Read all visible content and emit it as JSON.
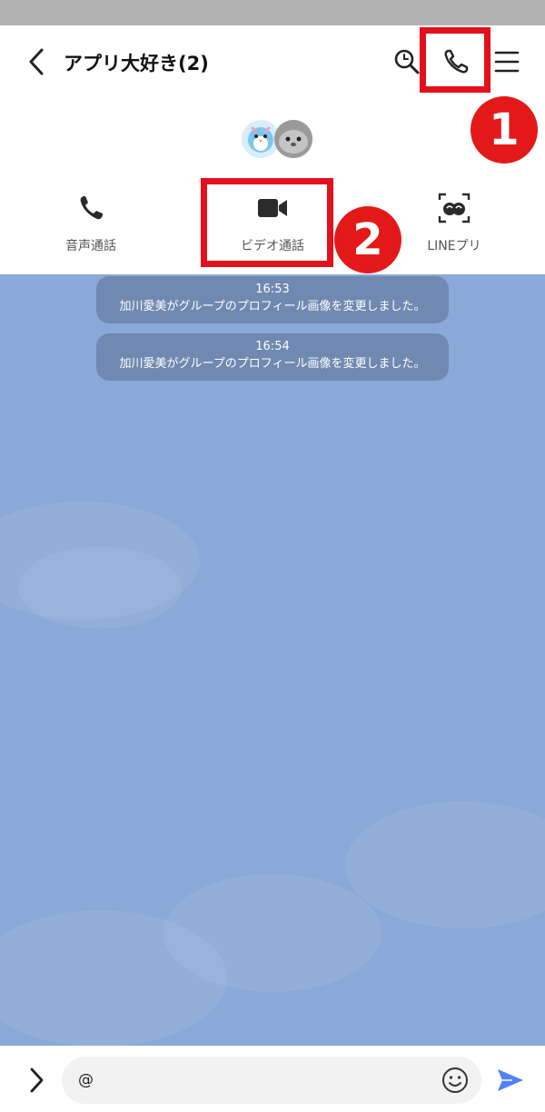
{
  "header": {
    "title": "アプリ大好き(2)",
    "back_icon": "back-arrow-icon",
    "search_icon": "search-icon",
    "call_icon": "phone-icon",
    "menu_icon": "hamburger-menu-icon"
  },
  "call_options": [
    {
      "label": "音声通話",
      "icon": "phone-icon"
    },
    {
      "label": "ビデオ通話",
      "icon": "video-camera-icon"
    },
    {
      "label": "LINEプリ",
      "icon": "line-puri-icon"
    }
  ],
  "annotations": {
    "badge_1": "1",
    "badge_2": "2",
    "color": "#e3101e"
  },
  "messages": [
    {
      "time": "16:53",
      "text": "加川愛美がグループのプロフィール画像を変更しました。"
    },
    {
      "time": "16:54",
      "text": "加川愛美がグループのプロフィール画像を変更しました。"
    }
  ],
  "input": {
    "value": "@",
    "emoji_icon": "emoji-icon",
    "send_icon": "send-icon",
    "expand_icon": "chevron-right-icon"
  },
  "colors": {
    "chat_background": "#8aa9d8",
    "send_accent": "#4f80f7"
  }
}
